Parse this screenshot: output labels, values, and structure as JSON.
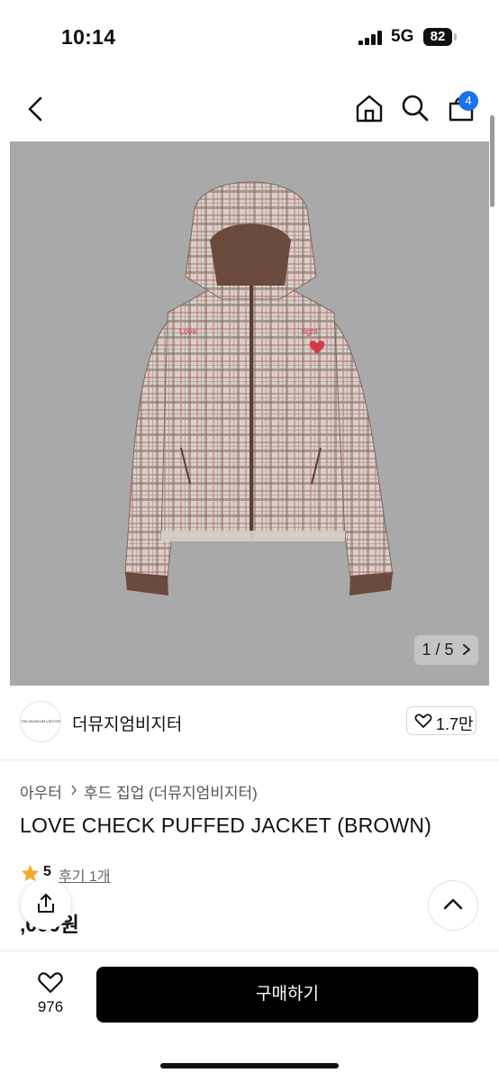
{
  "status": {
    "time": "10:14",
    "network": "5G",
    "battery": "82"
  },
  "nav": {
    "cart_count": "4"
  },
  "gallery": {
    "counter": "1 / 5",
    "love_text": "Love",
    "right_text": "right"
  },
  "brand": {
    "logo_text": "THE MUSEUM VISITOR",
    "name": "더뮤지엄비지터",
    "likes": "1.7만"
  },
  "breadcrumb": {
    "category": "아우터",
    "subcategory": "후드 집업 (더뮤지엄비지터)"
  },
  "product": {
    "title": "LOVE CHECK PUFFED JACKET (BROWN)",
    "rating": "5",
    "reviews": "후기 1개",
    "price": ",000원"
  },
  "bottom": {
    "wish_count": "976",
    "buy_label": "구매하기"
  },
  "colors": {
    "accent": "#1a73e8",
    "star": "#f5a623",
    "buy": "#000000"
  }
}
